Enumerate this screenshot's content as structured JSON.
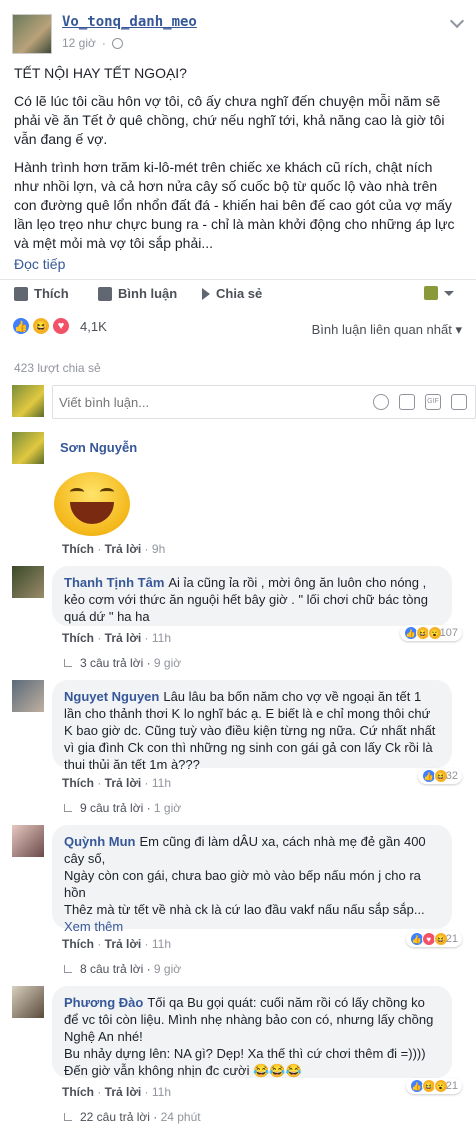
{
  "post": {
    "author": "Vo_tonq_danh_meo",
    "time": "12 giờ",
    "headline": "TẾT NỘI HAY TẾT NGOẠI?",
    "para1": "Có lẽ lúc tôi cầu hôn vợ tôi, cô ấy chưa nghĩ đến chuyện mỗi năm sẽ phải về ăn Tết ở quê chồng, chứ nếu nghĩ tới, khả năng cao là giờ tôi vẫn đang ế vợ.",
    "para2": "Hành trình hơn trăm ki-lô-mét trên chiếc xe khách cũ rích, chật ních như nhồi lợn, và cả hơn nửa cây số cuốc bộ từ quốc lộ vào nhà trên con đường quê lổn nhổn đất đá - khiến hai bên đế cao gót của vợ mấy lần lẹo trẹo như chực bung ra - chỉ là màn khởi động cho những áp lực và mệt mỏi mà vợ tôi sắp phải...",
    "read_more": "Đọc tiếp"
  },
  "actions": {
    "like": "Thích",
    "comment": "Bình luận",
    "share": "Chia sẻ"
  },
  "reactions": {
    "count": "4,1K",
    "sort": "Bình luận liên quan nhất ▾",
    "shares": "423 lượt chia sẻ"
  },
  "composer": {
    "placeholder": "Viết bình luận..."
  },
  "comments": [
    {
      "name": "Sơn Nguyễn",
      "text": "",
      "like": "Thích",
      "reply": "Trả lời",
      "time": "9h"
    },
    {
      "name": "Thanh Tịnh Tâm",
      "text": "Ai ỉa cũng ỉa rồi , mời ông ăn luôn cho nóng , kẻo cơm với thức ăn nguội hết bây giờ . \" lối chơi chữ bác tòng quá dứ \" ha ha",
      "like": "Thích",
      "reply": "Trả lời",
      "time": "11h",
      "react_count": "107",
      "replies": "3 câu trả lời",
      "replies_time": "9 giờ"
    },
    {
      "name": "Nguyet Nguyen",
      "text": "Lâu lâu ba bốn năm cho vợ về ngoại ăn tết 1 lần cho thảnh thơi K lo nghĩ bác ạ. E biết là e chỉ mong thôi chứ K bao giờ dc. Cũng tuỳ vào điều kiện từng ng nữa. Cứ nhất nhất vì gia đình Ck con thì những ng sinh con gái gả con lấy Ck rồi là thui thủi ăn tết 1m à???",
      "like": "Thích",
      "reply": "Trả lời",
      "time": "11h",
      "react_count": "32",
      "replies": "9 câu trả lời",
      "replies_time": "1 giờ"
    },
    {
      "name": "Quỳnh Mun",
      "text": "Em cũng đi làm dÂU xa, cách nhà mẹ đẻ gần 400 cây số,\nNgày còn con gái, chưa bao giờ mò vào bếp nấu món j cho ra hồn\nThêz mà từ tết về nhà ck là cứ lao đầu vakf nấu nấu sắp sắp...",
      "more": "Xem thêm",
      "like": "Thích",
      "reply": "Trả lời",
      "time": "11h",
      "react_count": "21",
      "replies": "8 câu trả lời",
      "replies_time": "9 giờ"
    },
    {
      "name": "Phương Đào",
      "text": "Tối qa Bu gọi quát: cuối năm rồi có lấy chồng ko để vc tôi còn liệu. Mình nhẹ nhàng bảo con có, nhưng lấy chồng Nghệ An nhé!\nBu nhảy dựng lên: NA gì? Dẹp! Xa thế thì cứ chơi thêm đi =))))\nĐến giờ vẫn không nhịn đc cười 😂😂😂",
      "like": "Thích",
      "reply": "Trả lời",
      "time": "11h",
      "react_count": "21",
      "replies": "22 câu trả lời",
      "replies_time": "24 phút"
    }
  ],
  "colors": {
    "link": "#365899",
    "like_blue": "#4080ff",
    "haha": "#f7b125",
    "love": "#f25268"
  }
}
